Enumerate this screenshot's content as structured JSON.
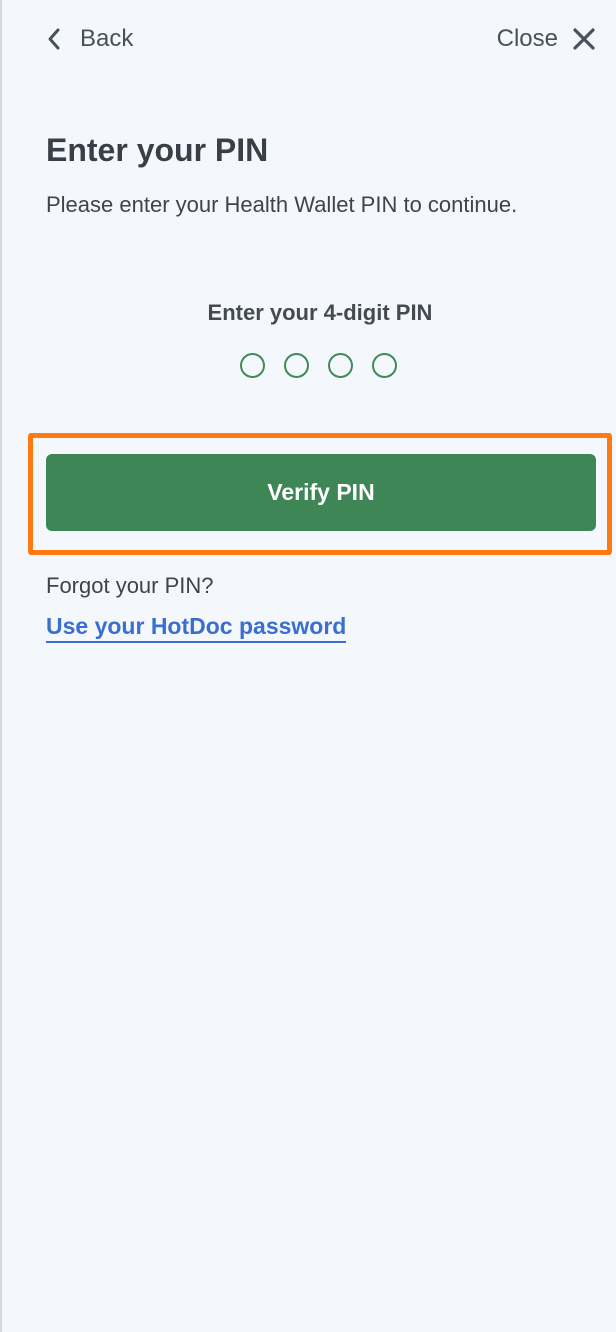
{
  "header": {
    "back_label": "Back",
    "close_label": "Close"
  },
  "content": {
    "title": "Enter your PIN",
    "subtitle": "Please enter your Health Wallet PIN to continue.",
    "pin_label": "Enter your 4-digit PIN",
    "pin_digits_entered": 0,
    "pin_length": 4,
    "verify_button_label": "Verify PIN",
    "forgot_text": "Forgot your PIN?",
    "password_link_label": "Use your HotDoc password"
  },
  "icons": {
    "back": "chevron-left-icon",
    "close": "close-icon"
  },
  "colors": {
    "background": "#f4f8fc",
    "primary_green": "#3e8656",
    "highlight": "#ff7b12",
    "link_blue": "#3a6fd0"
  }
}
